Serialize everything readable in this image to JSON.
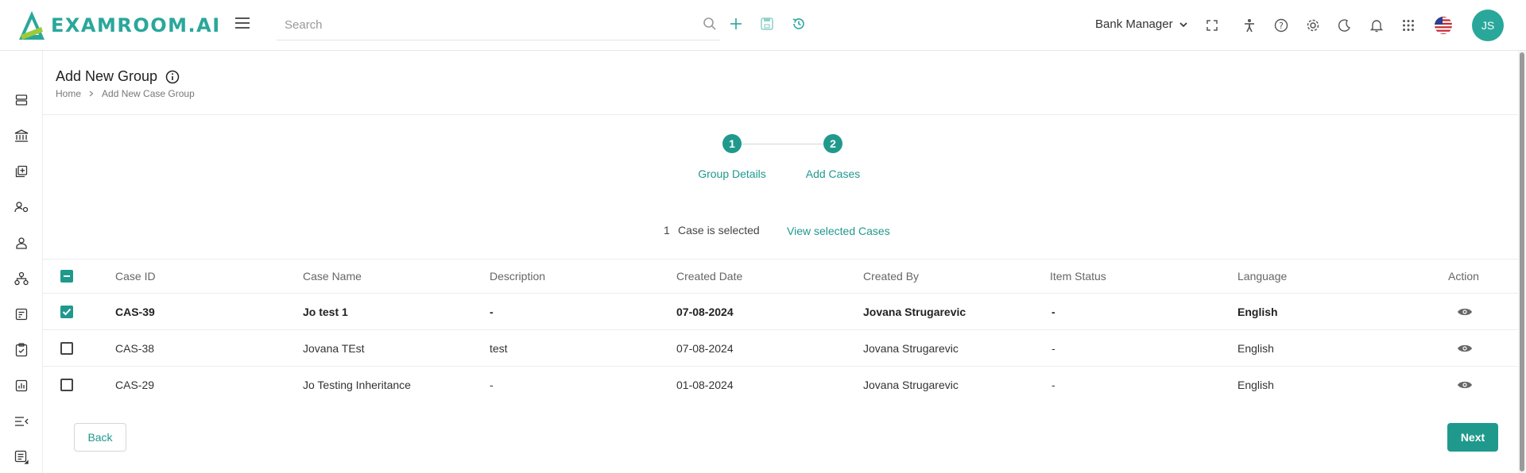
{
  "app": {
    "logo_text": "EXAMROOM.AI"
  },
  "topbar": {
    "search_placeholder": "Search",
    "role_label": "Bank Manager",
    "avatar_initials": "JS",
    "icons": [
      "search-icon",
      "add-icon",
      "save-icon",
      "history-icon",
      "fullscreen-icon",
      "accessibility-icon",
      "help-icon",
      "settings-icon",
      "dark-mode-icon",
      "notifications-icon",
      "apps-grid-icon",
      "us-flag-icon"
    ]
  },
  "sidebar": {
    "icons": [
      "server-icon",
      "bank-icon",
      "add-library-icon",
      "user-settings-icon",
      "user-icon",
      "hierarchy-icon",
      "document-edit-icon",
      "clipboard-icon",
      "report-chart-icon",
      "list-collapse-icon",
      "table-doc-icon"
    ]
  },
  "page": {
    "title": "Add New Group",
    "breadcrumb_home": "Home",
    "breadcrumb_current": "Add New Case Group"
  },
  "stepper": {
    "steps": [
      {
        "number": "1",
        "label": "Group Details"
      },
      {
        "number": "2",
        "label": "Add Cases"
      }
    ]
  },
  "selection": {
    "count": "1",
    "text": "Case is selected",
    "view_link": "View selected Cases"
  },
  "table": {
    "headers": [
      "Case ID",
      "Case Name",
      "Description",
      "Created Date",
      "Created By",
      "Item Status",
      "Language",
      "Action"
    ],
    "rows": [
      {
        "checked": true,
        "case_id": "CAS-39",
        "case_name": "Jo test 1",
        "description": "-",
        "created_date": "07-08-2024",
        "created_by": "Jovana Strugarevic",
        "item_status": "-",
        "language": "English"
      },
      {
        "checked": false,
        "case_id": "CAS-38",
        "case_name": "Jovana TEst",
        "description": "test",
        "created_date": "07-08-2024",
        "created_by": "Jovana Strugarevic",
        "item_status": "-",
        "language": "English"
      },
      {
        "checked": false,
        "case_id": "CAS-29",
        "case_name": "Jo Testing Inheritance",
        "description": "-",
        "created_date": "01-08-2024",
        "created_by": "Jovana Strugarevic",
        "item_status": "-",
        "language": "English"
      }
    ]
  },
  "footer": {
    "back_label": "Back",
    "next_label": "Next"
  },
  "colors": {
    "accent": "#20998d",
    "logo": "#2aa79b"
  }
}
